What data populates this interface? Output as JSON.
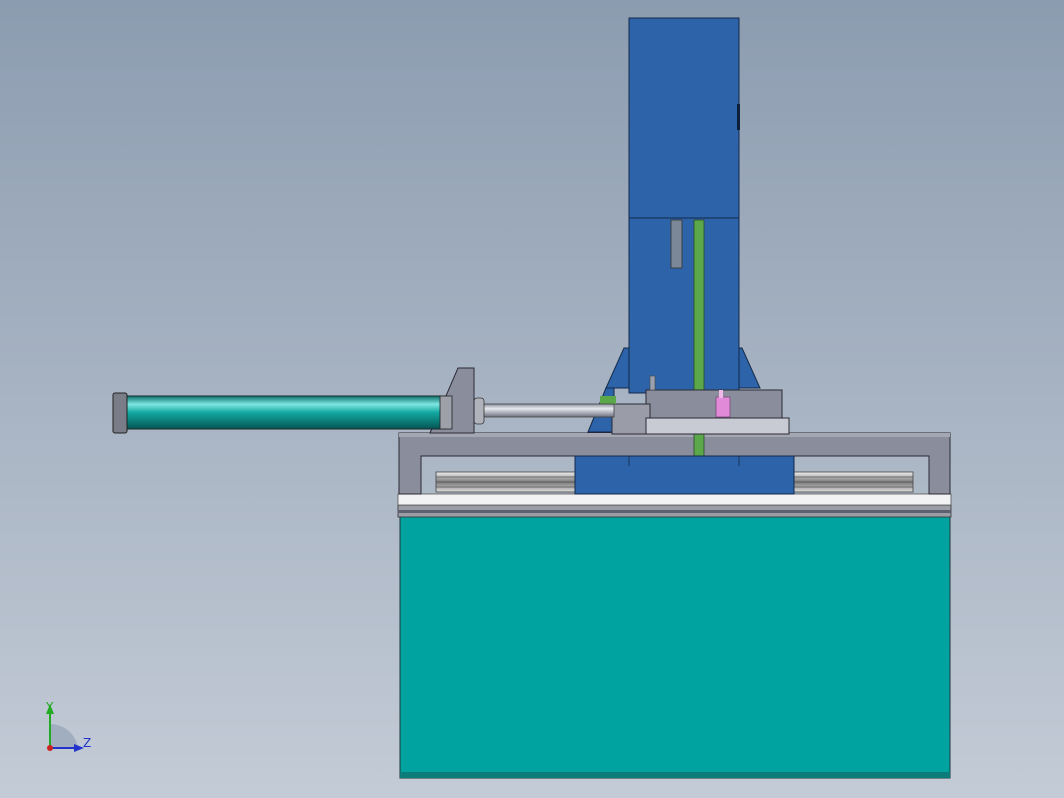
{
  "viewport": {
    "background_top": "#8c9cb0",
    "background_bottom": "#c3cbd6"
  },
  "model": {
    "colors": {
      "motor_blue": "#2d63a8",
      "motor_blue_dark": "#1d3f75",
      "base_teal": "#00a3a0",
      "cylinder_teal": "#0a8f8a",
      "frame_gray": "#8a8d9c",
      "frame_gray_light": "#b8bac6",
      "green_strip": "#5aa84a",
      "pin_pink": "#e08ad8"
    }
  },
  "triad": {
    "y_label": "Y",
    "z_label": "Z",
    "y_color": "#22aa22",
    "z_color": "#2233cc"
  }
}
